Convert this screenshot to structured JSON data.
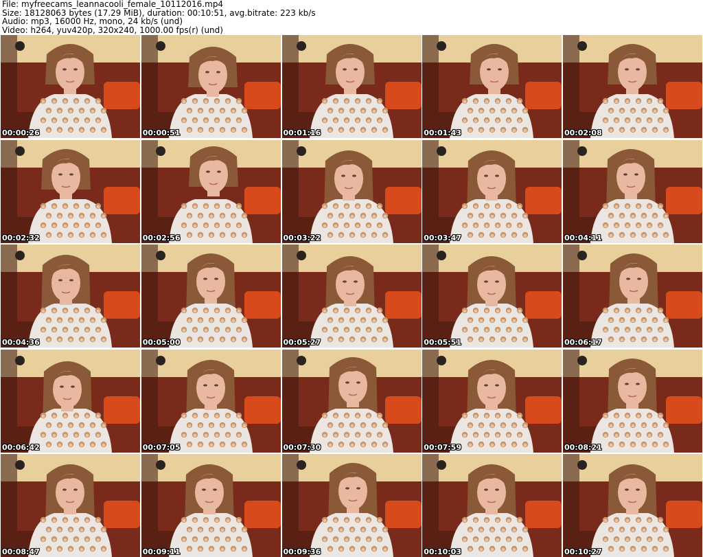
{
  "header": {
    "file_line": "File: myfreecams_leannacooli_female_10112016.mp4",
    "size_line": "Size: 18128063 bytes (17.29 MiB), duration: 00:10:51, avg.bitrate: 223 kb/s",
    "audio_line": "Audio: mp3, 16000 Hz, mono, 24 kb/s (und)",
    "video_line": "Video: h264, yuv420p, 320x240, 1000.00 fps(r) (und)"
  },
  "thumbnails": [
    {
      "timestamp": "00:00:26"
    },
    {
      "timestamp": "00:00:51"
    },
    {
      "timestamp": "00:01:16"
    },
    {
      "timestamp": "00:01:43"
    },
    {
      "timestamp": "00:02:08"
    },
    {
      "timestamp": "00:02:32"
    },
    {
      "timestamp": "00:02:56"
    },
    {
      "timestamp": "00:03:22"
    },
    {
      "timestamp": "00:03:47"
    },
    {
      "timestamp": "00:04:11"
    },
    {
      "timestamp": "00:04:36"
    },
    {
      "timestamp": "00:05:00"
    },
    {
      "timestamp": "00:05:27"
    },
    {
      "timestamp": "00:05:51"
    },
    {
      "timestamp": "00:06:17"
    },
    {
      "timestamp": "00:06:42"
    },
    {
      "timestamp": "00:07:05"
    },
    {
      "timestamp": "00:07:30"
    },
    {
      "timestamp": "00:07:59"
    },
    {
      "timestamp": "00:08:21"
    },
    {
      "timestamp": "00:08:47"
    },
    {
      "timestamp": "00:09:11"
    },
    {
      "timestamp": "00:09:36"
    },
    {
      "timestamp": "00:10:03"
    },
    {
      "timestamp": "00:10:27"
    }
  ],
  "colors": {
    "wall": "#e9cf9c",
    "curtain": "#7a2a1a",
    "cushion": "#d8491c",
    "skin": "#e9b8a0",
    "hair": "#8a5a38",
    "shirt": "#ebe6e2",
    "timestamp_text": "#ffffff",
    "timestamp_outline": "#000000"
  }
}
